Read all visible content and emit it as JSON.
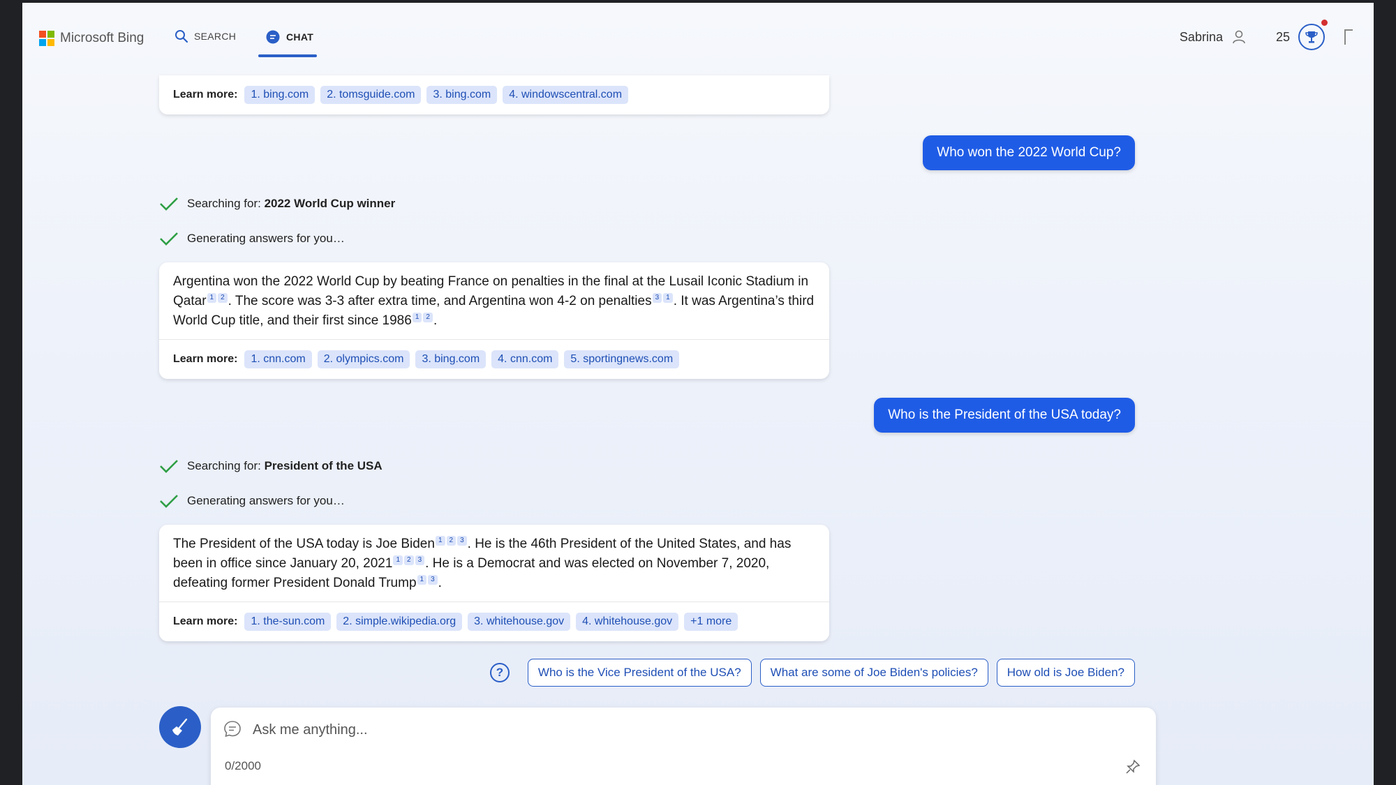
{
  "header": {
    "brand": "Microsoft Bing",
    "tabs": [
      {
        "label": "SEARCH",
        "icon": "search-icon"
      },
      {
        "label": "CHAT",
        "icon": "chat-icon",
        "active": true
      }
    ],
    "user_name": "Sabrina",
    "reward_points": "25"
  },
  "learn_more_label": "Learn more:",
  "conversation": {
    "prev_sources": [
      "1. bing.com",
      "2. tomsguide.com",
      "3. bing.com",
      "4. windowscentral.com"
    ],
    "q1": "Who won the 2022 World Cup?",
    "q1_search_prefix": "Searching for: ",
    "q1_search_term": "2022 World Cup winner",
    "generating": "Generating answers for you…",
    "a1": {
      "t1": "Argentina won the 2022 World Cup by beating France on penalties in the final at the Lusail Iconic Stadium in Qatar",
      "t2": ". The score was 3-3 after extra time, and Argentina won 4-2 on penalties",
      "t3": ". It was Argentina’s third World Cup title, and their first since 1986",
      "t4": "."
    },
    "a1_sources": [
      "1. cnn.com",
      "2. olympics.com",
      "3. bing.com",
      "4. cnn.com",
      "5. sportingnews.com"
    ],
    "q2": "Who is the President of the USA today?",
    "q2_search_prefix": "Searching for: ",
    "q2_search_term": "President of the USA",
    "a2": {
      "t1": "The President of the USA today is Joe Biden",
      "t2": ". He is the 46th President of the United States, and has been in office since January 20, 2021",
      "t3": ". He is a Democrat and was elected on November 7, 2020, defeating former President Donald Trump",
      "t4": "."
    },
    "a2_sources": [
      "1. the-sun.com",
      "2. simple.wikipedia.org",
      "3. whitehouse.gov",
      "4. whitehouse.gov",
      "+1 more"
    ]
  },
  "suggestions": [
    "Who is the Vice President of the USA?",
    "What are some of Joe Biden's policies?",
    "How old is Joe Biden?"
  ],
  "composer": {
    "placeholder": "Ask me anything...",
    "char_count": "0/2000"
  },
  "colors": {
    "accent": "#2b5fc7",
    "user_bubble": "#1f5ce6",
    "chip_bg": "#dbe4fa",
    "check": "#2e9e44"
  }
}
